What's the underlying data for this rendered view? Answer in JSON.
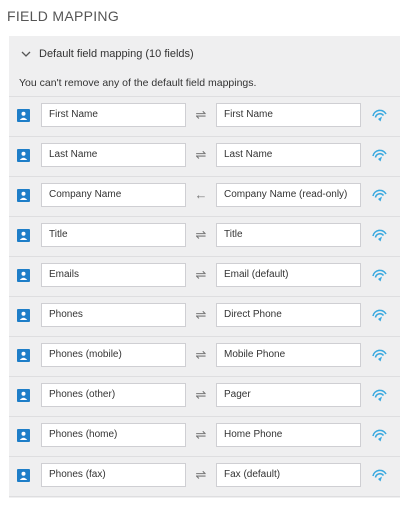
{
  "page": {
    "title": "FIELD MAPPING"
  },
  "section": {
    "header": "Default field mapping (10 fields)",
    "note": "You can't remove any of the default field mappings."
  },
  "colors": {
    "contact_icon": "#1e7ec8",
    "sync_icon": "#39a9e0",
    "panel_bg": "#efeff0"
  },
  "rows": [
    {
      "left": "First Name",
      "arrow": "⇌",
      "right": "First Name"
    },
    {
      "left": "Last Name",
      "arrow": "⇌",
      "right": "Last Name"
    },
    {
      "left": "Company Name",
      "arrow": "←",
      "right": "Company Name (read-only)"
    },
    {
      "left": "Title",
      "arrow": "⇌",
      "right": "Title"
    },
    {
      "left": "Emails",
      "arrow": "⇌",
      "right": "Email (default)"
    },
    {
      "left": "Phones",
      "arrow": "⇌",
      "right": "Direct Phone"
    },
    {
      "left": "Phones (mobile)",
      "arrow": "⇌",
      "right": "Mobile Phone"
    },
    {
      "left": "Phones (other)",
      "arrow": "⇌",
      "right": "Pager"
    },
    {
      "left": "Phones (home)",
      "arrow": "⇌",
      "right": "Home Phone"
    },
    {
      "left": "Phones (fax)",
      "arrow": "⇌",
      "right": "Fax (default)"
    }
  ]
}
